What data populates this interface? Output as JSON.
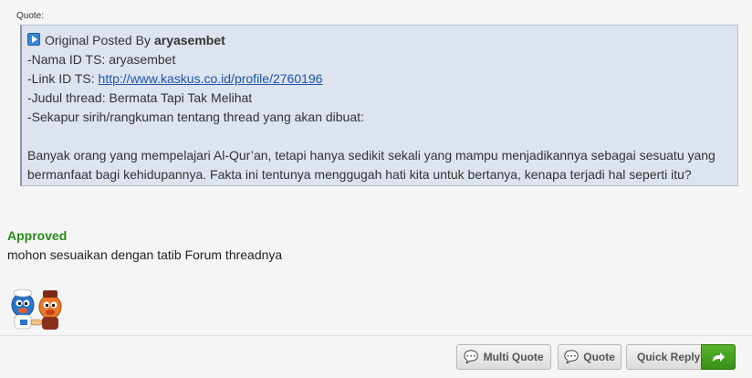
{
  "quote": {
    "label": "Quote:",
    "header_prefix": "Original Posted By",
    "poster": "aryasembet",
    "lines": [
      "-Nama ID TS: aryasembet",
      "-Link ID TS:",
      "-Judul thread: Bermata Tapi Tak Melihat",
      "-Sekapur sirih/rangkuman tentang thread yang akan dibuat:"
    ],
    "link_text": "http://www.kaskus.co.id/profile/2760196",
    "paragraph": "Banyak orang yang mempelajari Al-Qur’an, tetapi hanya sedikit sekali yang mampu menjadikannya sebagai sesuatu yang bermanfaat bagi kehidupannya. Fakta ini tentunya menggugah hati kita untuk bertanya, kenapa terjadi hal seperti itu?"
  },
  "post": {
    "status": "Approved",
    "message": "mohon sesuaikan dengan tatib Forum threadnya"
  },
  "buttons": {
    "multi_quote": "Multi Quote",
    "quote": "Quote",
    "quick_reply": "Quick Reply"
  },
  "icons": [
    "viewpost-icon",
    "speech-bubble-icon",
    "reply-arrow-icon",
    "kaskus-mascot-emoticon"
  ],
  "colors": {
    "quote_bg": "#dde3ef",
    "approved": "#2b8a1b",
    "link": "#1a55a8",
    "reply_green": "#3a8f17"
  }
}
